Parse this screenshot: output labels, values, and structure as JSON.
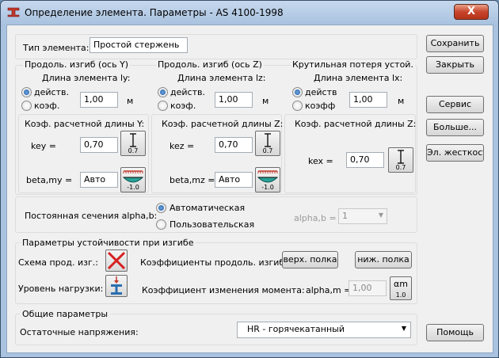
{
  "window": {
    "title": "Определение элемента. Параметры - AS 4100-1998",
    "close_label": "X"
  },
  "element_type": {
    "label": "Тип элемента:",
    "value": "Простой стержень"
  },
  "buttons": {
    "save": "Сохранить",
    "close": "Закрыть",
    "service": "Сервис",
    "more": "Больше...",
    "stiffness": "Эл. жесткости",
    "help": "Помощь"
  },
  "buckling_y": {
    "title": "Продоль. изгиб (ось Y)",
    "length_label": "Длина элемента ly:",
    "opt_actual": "действ.",
    "opt_coef": "коэф.",
    "value": "1,00",
    "unit": "м"
  },
  "buckling_z": {
    "title": "Продоль. изгиб (ось Z)",
    "length_label": "Длина элемента lz:",
    "opt_actual": "действ.",
    "opt_coef": "коэф.",
    "value": "1,00",
    "unit": "м"
  },
  "torsion": {
    "title": "Крутильная потеря устой.",
    "length_label": "Длина элемента lx:",
    "opt_actual": "действ",
    "opt_coef": "коэфф",
    "value": "1,00",
    "unit": "м"
  },
  "coef_y": {
    "title": "Коэф. расчетной длины Y:",
    "key_label": "key =",
    "key_value": "0,70",
    "key_icon_num": "0.7",
    "beta_label": "beta,my =",
    "beta_value": "Авто",
    "beta_icon_num": "-1.0"
  },
  "coef_z": {
    "title": "Коэф. расчетной длины Z:",
    "key_label": "kez =",
    "key_value": "0,70",
    "key_icon_num": "0.7",
    "beta_label": "beta,mz =",
    "beta_value": "Авто",
    "beta_icon_num": "-1.0"
  },
  "coef_x": {
    "title": "Коэф. расчетной длины  Z:",
    "key_label": "kex =",
    "key_value": "0,70",
    "key_icon_num": "0.7"
  },
  "alpha_b": {
    "label": "Постоянная сечения alpha,b:",
    "opt_auto": "Автоматическая",
    "opt_user": "Пользовательская",
    "value_label": "alpha,b =",
    "value": "1"
  },
  "lateral": {
    "title": "Параметры устойчивости при изгибе",
    "scheme_label": "Схема прод. изг.:",
    "load_level_label": "Уровень нагрузки:",
    "coef_label": "Коэффициенты продоль. изгиба:",
    "top_flange": "верх. полка",
    "bottom_flange": "ниж. полка",
    "moment_label": "Коэффициент изменения момента:",
    "alpha_m_label": "alpha,m =",
    "alpha_m_value": "1,00",
    "alpha_m_icon_top": "αm",
    "alpha_m_icon_num": "1.0"
  },
  "general": {
    "title": "Общие параметры",
    "residual_label": "Остаточные напряжения:",
    "residual_value": "HR - горячекатанный"
  },
  "colors": {
    "cross": "#d62020",
    "beam": "#1a5a9a",
    "beam_teal": "#2aa198",
    "load": "#c0392b"
  }
}
